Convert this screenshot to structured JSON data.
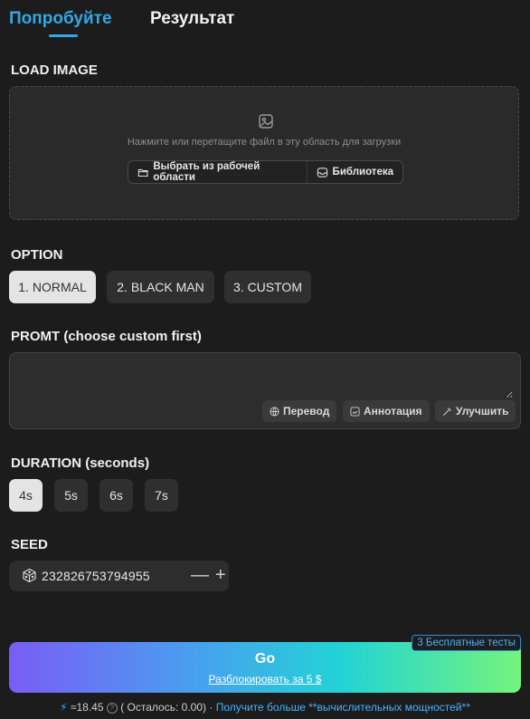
{
  "tabs": {
    "try": "Попробуйте",
    "result": "Результат"
  },
  "load_image": {
    "label": "LOAD IMAGE",
    "hint": "Нажмите или перетащите файл в эту область для загрузки",
    "workspace_button": "Выбрать из рабочей области",
    "library_button": "Библиотека"
  },
  "option": {
    "label": "OPTION",
    "items": [
      "1. NORMAL",
      "2. BLACK MAN",
      "3. CUSTOM"
    ],
    "selected": "1. NORMAL"
  },
  "prompt": {
    "label": "PROMT (choose custom first)",
    "value": "",
    "tools": {
      "translate": "Перевод",
      "annotate": "Аннотация",
      "improve": "Улучшить"
    }
  },
  "duration": {
    "label": "DURATION (seconds)",
    "items": [
      "4s",
      "5s",
      "6s",
      "7s"
    ],
    "selected": "4s"
  },
  "seed": {
    "label": "SEED",
    "value": "232826753794955",
    "minus": "—",
    "plus": "+"
  },
  "go": {
    "label": "Go",
    "unlock": "Разблокировать за 5 $",
    "badge": "3 Бесплатные тесты"
  },
  "footer": {
    "cost": "≈18.45",
    "remaining": "( Осталось: 0.00) ·",
    "link": "Получите больше **вычислительных мощностей**"
  },
  "colors": {
    "accent": "#33a6e6",
    "background": "#1c1c1c",
    "selected_button": "#e4e4e4"
  }
}
